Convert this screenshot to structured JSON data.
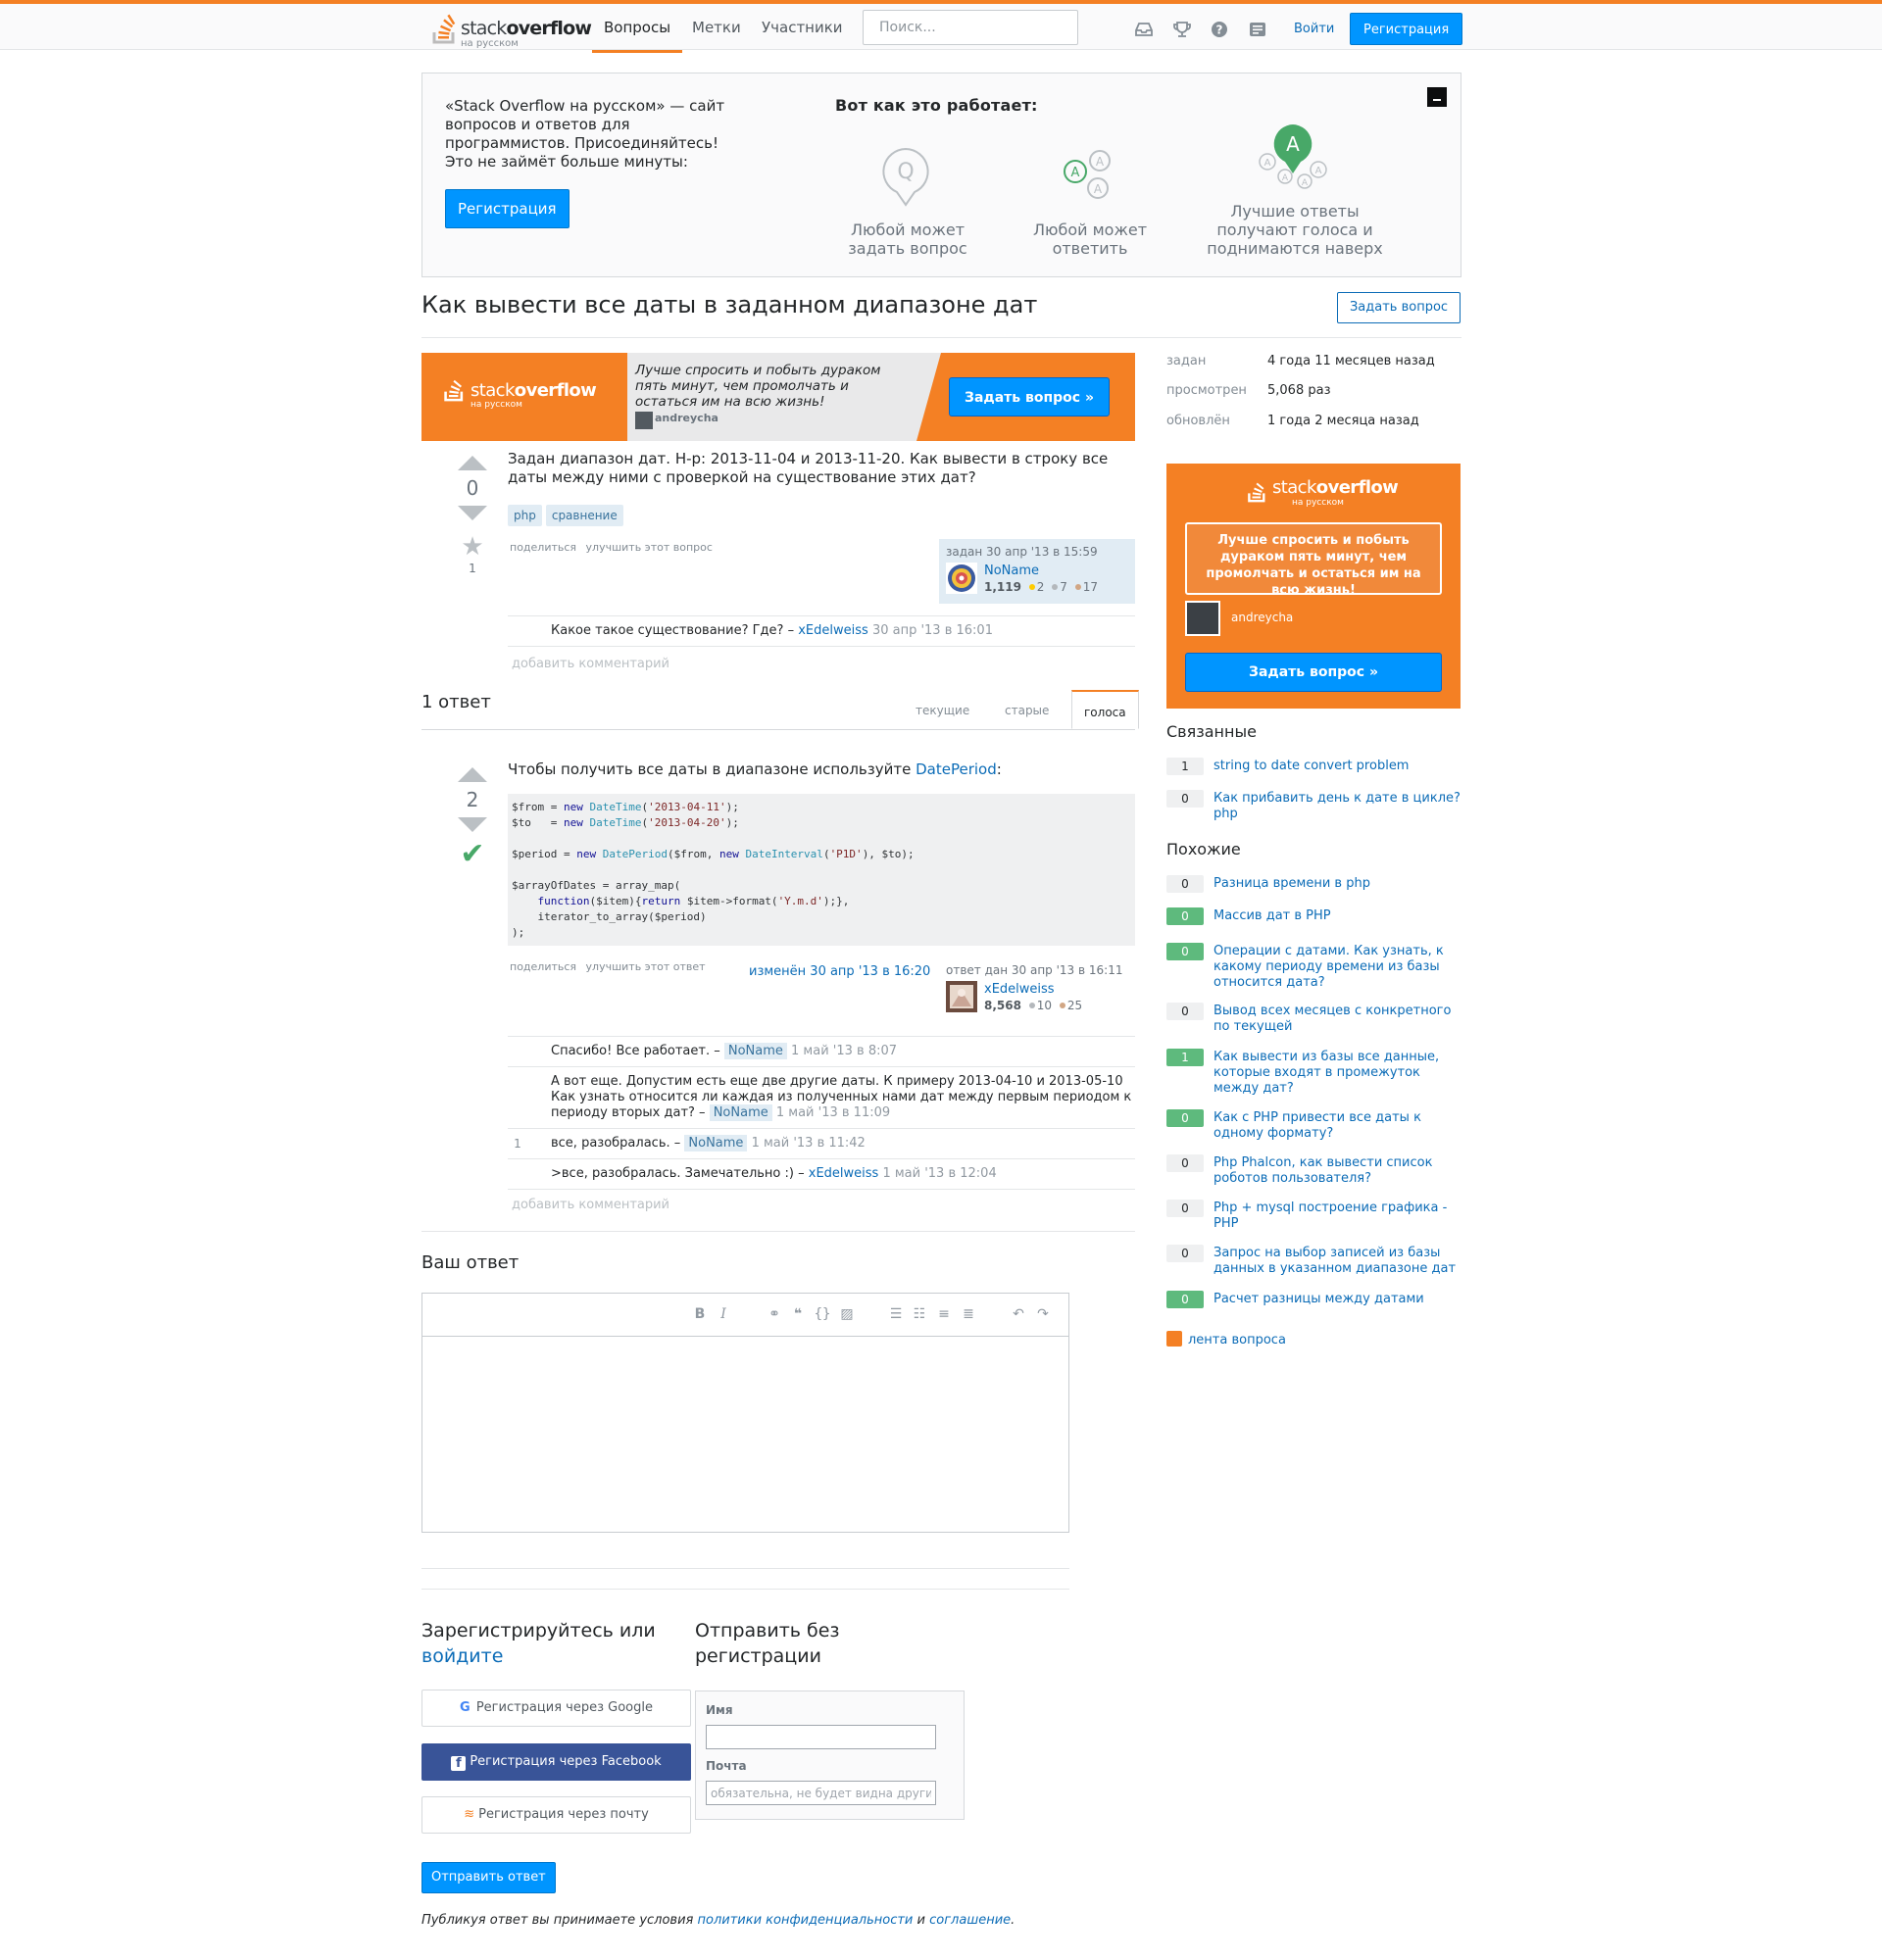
{
  "header": {
    "logo_main": "stack",
    "logo_bold": "overflow",
    "logo_sub": "на русском",
    "nav": [
      "Вопросы",
      "Метки",
      "Участники"
    ],
    "search_placeholder": "Поиск...",
    "login": "Войти",
    "signup": "Регистрация",
    "icons": [
      "inbox-icon",
      "trophy-icon",
      "help-icon",
      "review-icon"
    ]
  },
  "hero": {
    "intro": "«Stack Overflow на русском» — сайт вопросов и ответов для программистов. Присоединяйтесь! Это не займёт больше минуты:",
    "signup_button": "Регистрация",
    "how_title": "Вот как это работает:",
    "steps": [
      "Любой может задать вопрос",
      "Любой может ответить",
      "Лучшие ответы получают голоса и поднимаются наверх"
    ]
  },
  "question": {
    "title": "Как вывести все даты в заданном диапазоне дат",
    "ask_button": "Задать вопрос",
    "votes": "0",
    "favorites": "1",
    "body": "Задан диапазон дат. Н-р: 2013-11-04 и 2013-11-20. Как вывести в строку все даты между ними с проверкой на существование этих дат?",
    "tags": [
      "php",
      "сравнение"
    ],
    "menu": [
      "поделиться",
      "улучшить этот вопрос"
    ],
    "asked_label": "задан 30 апр '13 в 15:59",
    "owner_name": "NoName",
    "owner_rep": "1,119",
    "owner_silver": "2",
    "owner_bronze_gray": "7",
    "owner_bronze": "17",
    "comments": [
      {
        "text": "Какое такое существование? Где? –",
        "user": "xEdelweiss",
        "date": "30 апр '13 в 16:01"
      }
    ],
    "add_comment": "добавить комментарий"
  },
  "banner": {
    "logo_main": "stack",
    "logo_bold": "overflow",
    "logo_sub": "на русском",
    "quote": "Лучше спросить и побыть дураком пять минут, чем промолчать и остаться им на всю жизнь!",
    "author": "andreycha",
    "button": "Задать вопрос »"
  },
  "answers": {
    "count_label": "1 ответ",
    "tabs": [
      "текущие",
      "старые",
      "голоса"
    ],
    "active_tab": "голоса"
  },
  "answer": {
    "votes": "2",
    "intro": "Чтобы получить все даты в диапазоне используйте",
    "link": "DatePeriod",
    "after_link": ":",
    "menu": [
      "поделиться",
      "улучшить этот ответ"
    ],
    "edited_label": "изменён 30 апр '13 в 16:20",
    "answered_label": "ответ дан 30 апр '13 в 16:11",
    "author_name": "xEdelweiss",
    "author_rep": "8,568",
    "author_bronze_gray": "10",
    "author_bronze": "25",
    "comments": [
      {
        "score": "",
        "text": "Спасибо! Все работает. –",
        "user": "NoName",
        "op": true,
        "date": "1 май '13 в 8:07"
      },
      {
        "score": "",
        "text": "А вот еще. Допустим есть еще две другие даты. К примеру 2013-04-10 и 2013-05-10 Как узнать относится ли каждая из полученных нами дат между первым периодом к периоду вторых дат? –",
        "user": "NoName",
        "op": true,
        "date": "1 май '13 в 11:09"
      },
      {
        "score": "1",
        "text": "все, разобралась. –",
        "user": "NoName",
        "op": true,
        "date": "1 май '13 в 11:42"
      },
      {
        "score": "",
        "text": ">все, разобралась. Замечательно :) –",
        "user": "xEdelweiss",
        "op": false,
        "date": "1 май '13 в 12:04"
      }
    ],
    "add_comment": "добавить комментарий"
  },
  "your_answer": {
    "title": "Ваш ответ",
    "editor_tools": [
      "B",
      "I"
    ],
    "signup_title": "Зарегистрируйтесь или",
    "signup_link": "войдите",
    "guest_title": "Отправить без регистрации",
    "google": "Регистрация через Google",
    "facebook": "Регистрация через Facebook",
    "email": "Регистрация через почту",
    "name_label": "Имя",
    "email_label": "Почта",
    "email_placeholder": "обязательна, не будет видна другим",
    "post_button": "Отправить ответ",
    "legal_prefix": "Публикуя ответ вы принимаете условия",
    "legal_privacy": "политики конфиденциальности",
    "legal_and": "и",
    "legal_terms": "соглашение",
    "legal_end": "."
  },
  "sidebar": {
    "meta": [
      {
        "label": "задан",
        "value": "4 года 11 месяцев назад"
      },
      {
        "label": "просмотрен",
        "value": "5,068 раз"
      },
      {
        "label": "обновлён",
        "value": "1 года 2 месяца назад"
      }
    ],
    "ad": {
      "logo_main": "stack",
      "logo_bold": "overflow",
      "logo_sub": "на русском",
      "quote": "Лучше спросить и побыть дураком пять минут, чем промолчать и остаться им на всю жизнь!",
      "author": "andreycha",
      "button": "Задать вопрос »"
    },
    "linked_title": "Связанные",
    "linked": [
      {
        "count": "1",
        "answered": false,
        "title": "string to date convert problem"
      },
      {
        "count": "0",
        "answered": false,
        "title": "Как прибавить день к дате в цикле? php"
      }
    ],
    "related_title": "Похожие",
    "related": [
      {
        "count": "0",
        "answered": false,
        "title": "Разница времени в php"
      },
      {
        "count": "0",
        "answered": true,
        "title": "Массив дат в PHP"
      },
      {
        "count": "0",
        "answered": true,
        "title": "Операции с датами. Как узнать, к какому периоду времени из базы относится дата?"
      },
      {
        "count": "0",
        "answered": false,
        "title": "Вывод всех месяцев с конкретного по текущей"
      },
      {
        "count": "1",
        "answered": true,
        "title": "Как вывести из базы все данные, которые входят в промежуток между дат?"
      },
      {
        "count": "0",
        "answered": true,
        "title": "Как с PHP привести все даты к одному формату?"
      },
      {
        "count": "0",
        "answered": false,
        "title": "Php Phalcon, как вывести список роботов пользователя?"
      },
      {
        "count": "0",
        "answered": false,
        "title": "Php + mysql построение графика - PHP"
      },
      {
        "count": "0",
        "answered": false,
        "title": "Запрос на выбор записей из базы данных в указанном диапазоне дат"
      },
      {
        "count": "0",
        "answered": true,
        "title": "Расчет разницы между датами"
      }
    ],
    "feed": "лента вопроса"
  },
  "colors": {
    "accent": "#f48024",
    "link": "#0c6cb7",
    "button": "#0095ff",
    "answered": "#5eba7d"
  }
}
